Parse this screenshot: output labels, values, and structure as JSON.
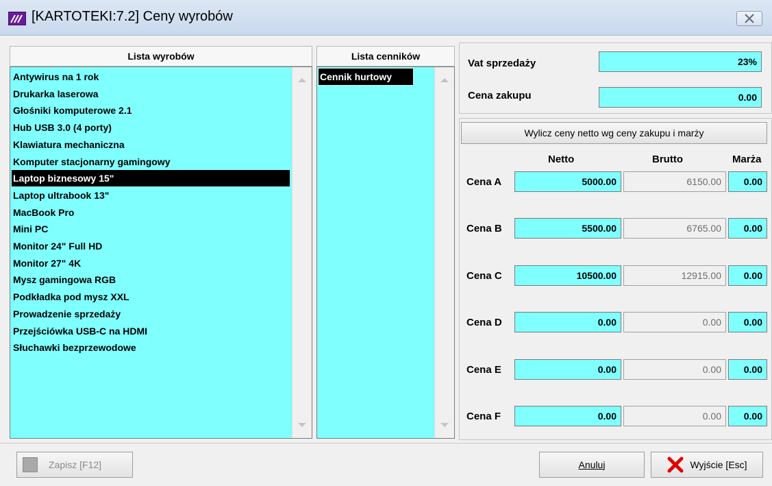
{
  "window": {
    "title": "[KARTOTEKI:7.2]  Ceny wyrobów"
  },
  "products": {
    "header": "Lista wyrobów",
    "items": [
      "Antywirus na 1 rok",
      "Drukarka laserowa",
      "Głośniki komputerowe 2.1",
      "Hub USB 3.0 (4 porty)",
      "Klawiatura mechaniczna",
      "Komputer stacjonarny gamingowy",
      "Laptop biznesowy 15\"",
      "Laptop ultrabook 13\"",
      "MacBook Pro",
      "Mini PC",
      "Monitor 24\" Full HD",
      "Monitor 27\" 4K",
      "Mysz gamingowa RGB",
      "Podkładka pod mysz XXL",
      "Prowadzenie sprzedaży",
      "Przejściówka USB-C na HDMI",
      "Słuchawki bezprzewodowe"
    ],
    "selected_index": 6
  },
  "pricelists": {
    "header": "Lista cenników",
    "items": [
      "Cennik hurtowy"
    ],
    "selected_index": 0
  },
  "vat": {
    "label": "Vat sprzedaży",
    "value": "23%"
  },
  "purchase": {
    "label": "Cena zakupu",
    "value": "0.00"
  },
  "calc_button": "Wylicz ceny netto wg ceny zakupu i marży",
  "columns": {
    "netto": "Netto",
    "brutto": "Brutto",
    "marza": "Marża"
  },
  "prices": [
    {
      "label": "Cena A",
      "netto": "5000.00",
      "brutto": "6150.00",
      "marza": "0.00"
    },
    {
      "label": "Cena B",
      "netto": "5500.00",
      "brutto": "6765.00",
      "marza": "0.00"
    },
    {
      "label": "Cena C",
      "netto": "10500.00",
      "brutto": "12915.00",
      "marza": "0.00"
    },
    {
      "label": "Cena D",
      "netto": "0.00",
      "brutto": "0.00",
      "marza": "0.00"
    },
    {
      "label": "Cena E",
      "netto": "0.00",
      "brutto": "0.00",
      "marza": "0.00"
    },
    {
      "label": "Cena F",
      "netto": "0.00",
      "brutto": "0.00",
      "marza": "0.00"
    }
  ],
  "footer": {
    "save_label": "Zapisz  [F12]",
    "cancel_label": "Anuluj",
    "exit_label": "Wyjście [Esc]"
  },
  "colors": {
    "list_bg": "#80ffff",
    "selected_bg": "#000000",
    "exit_icon": "#e00000"
  }
}
